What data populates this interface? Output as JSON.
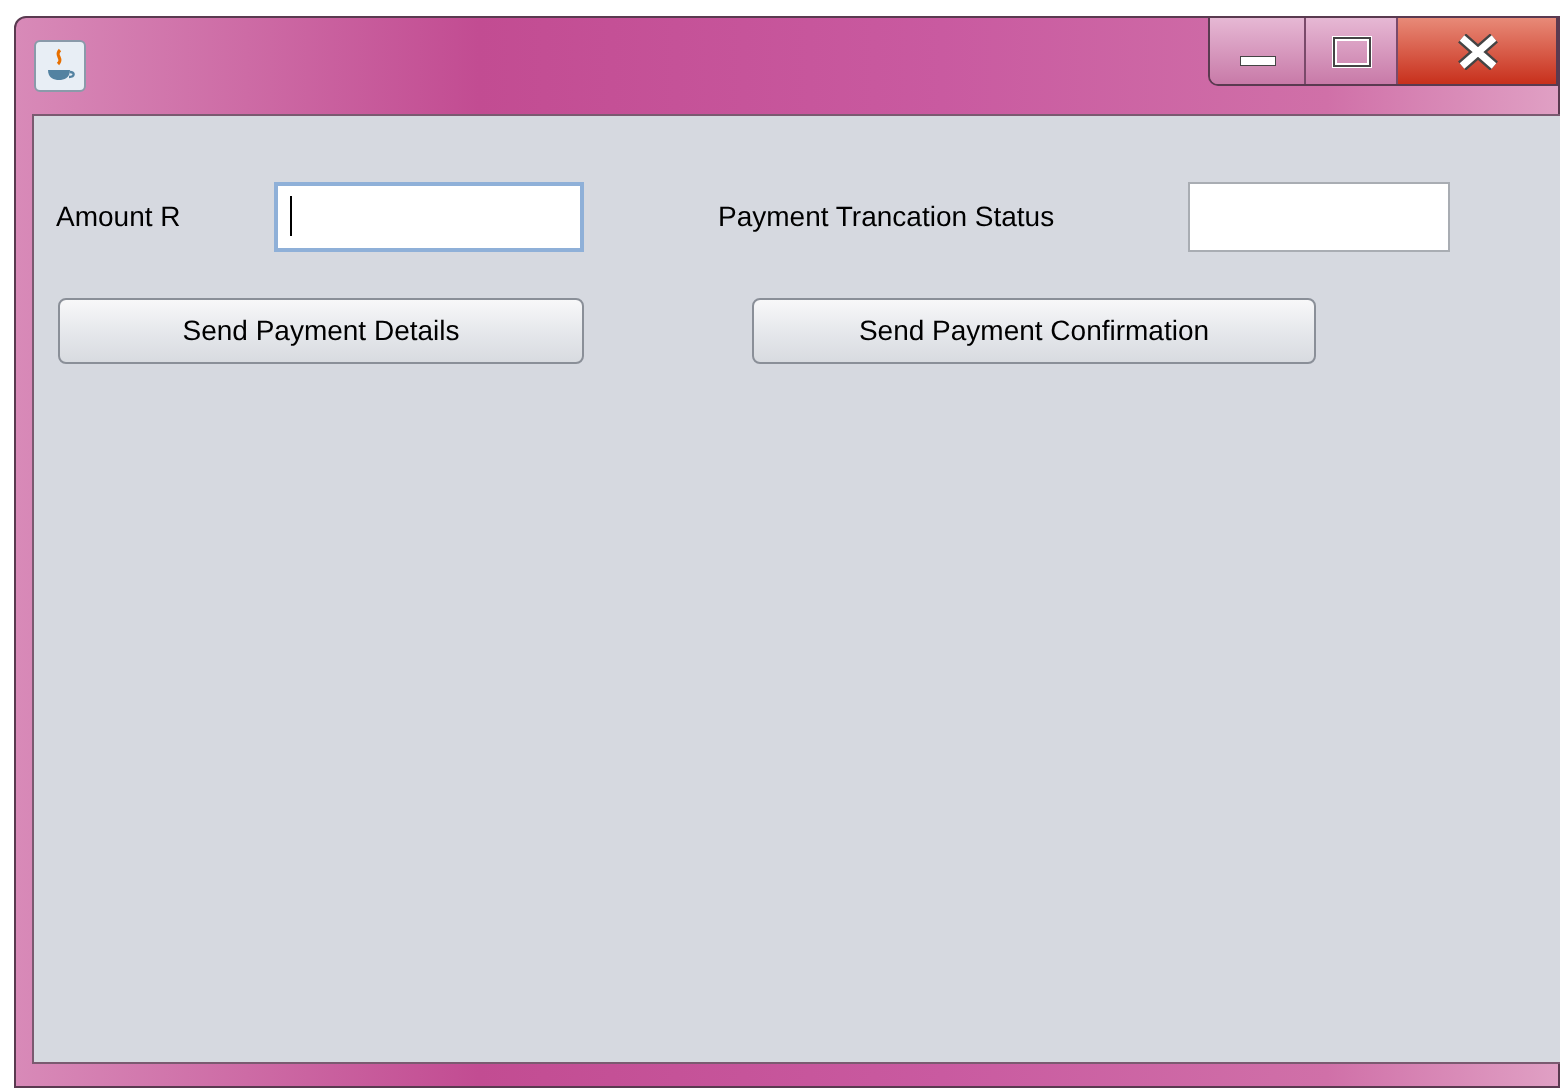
{
  "fields": [
    {
      "label": "Amount R",
      "focused": true
    },
    {
      "label": "Payment Trancation Status",
      "focused": false
    }
  ],
  "buttons": [
    "Send Payment Details",
    "Send Payment Confirmation"
  ]
}
